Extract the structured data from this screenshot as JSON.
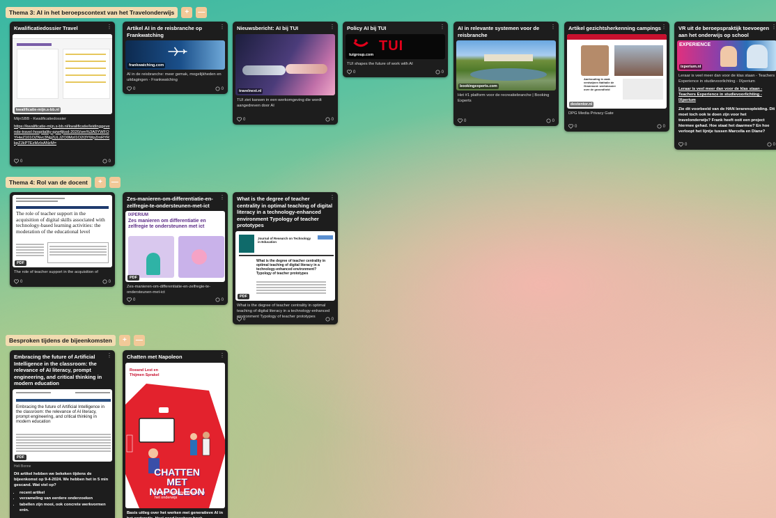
{
  "sections": [
    {
      "title": "Thema 3: AI in het beroepscontext van het Travelonderwijs",
      "cards": [
        {
          "title": "Kwalificatiedossier Travel",
          "thumb_source": "kwalificatie-mijn.s-bb.nl",
          "desc": "MijnSBB - Kwalificatiedossier",
          "link": "https://kwalificatie-mijn.s-bb.nl/kwalificatie/leidinggevende-travel-hospitality-qzw4jkxd-2020/om%3A0YWFOYHwZ101OZNvc3Ng2ULJZO0MzI1O2I3YWpZmRYRkpZJkPTEzMzIxANzM=",
          "likes": "0",
          "comments": "0"
        },
        {
          "title": "Artikel AI in de reisbranche op Frankwatching",
          "thumb_source": "frankwatching.com",
          "desc": "AI in de reisbranche: meer gemak, mogelijkheden en uitdagingen - Frankwatching",
          "likes": "0",
          "comments": "0"
        },
        {
          "title": "Nieuwsbericht: AI bij TUI",
          "thumb_source": "travelnext.nl",
          "desc": "TUI ziet kansen in een werkomgeving die wordt aangedreven door AI",
          "likes": "0",
          "comments": "0"
        },
        {
          "title": "Policy AI bij TUI",
          "thumb_source": "tuigroup.com",
          "logo_text": "TUI",
          "desc": "TUI shapes the future of work with AI",
          "likes": "0",
          "comments": "0"
        },
        {
          "title": "AI in relevante systemen voor de reisbranche",
          "thumb_source": "bookingexperts.com",
          "desc": "Het #1 platform voor de recreatiebranche | Booking Experts",
          "likes": "0",
          "comments": "0"
        },
        {
          "title": "Artikel gezichtsherkenning campings",
          "thumb_source": "destentor.nl",
          "thumb_caption": "Aanhouding in zaak verdwijnen Nathalie de Grammont: werkdossier over de gezondheid",
          "desc": "DPG Media Privacy Gate",
          "likes": "0",
          "comments": "0"
        },
        {
          "title": "VR uit de beroepspraktijk toevoegen aan het onderwijs op school",
          "thumb_source": "ixperium.nl",
          "thumb_label": "EXPERIENCE",
          "desc": "Leraar is veel meer dan voor de klas staan - Teachers Experience in studievoorlichting - IXperium",
          "link": "Leraar is veel meer dan voor de klas staan - Teachers Experience in studievoorlichting - IXperium",
          "body": "Zie dit voorbeeld van de HAN lerarenopleiding. Dit moet toch ook te doen zijn voor het travelonderwijs? Frank heeft ooit een project hiermee gehad. Hoe staat het daarmee? En hoe verloopt het lijntje tussen Marcella en Diane?",
          "likes": "0",
          "comments": "0"
        }
      ]
    },
    {
      "title": "Thema 4: Rol van de docent",
      "cards": [
        {
          "title": "",
          "paper_heading": "The role of teacher support in the acquisition of digital skills associated with technology-based learning activities: the moderation of the educational level",
          "badge": "PDF",
          "desc": "The role of teacher support in the acquisition of",
          "likes": "0",
          "comments": "0"
        },
        {
          "title": "Zes-manieren-om-differentiatie-en-zelfregie-te-ondersteunen-met-ict",
          "thumb_label": "IXPERIUM",
          "thumb_heading": "Zes manieren om differentiatie en zelfregie te ondersteunen met ict",
          "badge": "PDF",
          "desc": "Zes-manieren-om-differentiatie-en-zelfregie-te-ondersteunen-met-ict",
          "likes": "0",
          "comments": "0"
        },
        {
          "title": "What is the degree of teacher centrality in optimal teaching of digital literacy in a technology-enhanced environment Typology of teacher prototypes",
          "journal": "Journal of Research on Technology in Education",
          "paper_heading": "What is the degree of teacher centrality in optimal teaching of digital literacy in a technology-enhanced environment? Typology of teacher prototypes",
          "badge": "PDF",
          "desc": "What is the degree of teacher centrality in optimal teaching of digital literacy in a technology-enhanced environment Typology of teacher prototypes",
          "likes": "0",
          "comments": "0"
        }
      ]
    },
    {
      "title": "Besproken tijdens de bijeenkomsten",
      "cards": [
        {
          "title": "Embracing the future of Artificial Intelligence in the classroom: the relevance of AI literacy, prompt engineering, and critical thinking in modern education",
          "paper_heading": "Embracing the future of Artificial Intelligence in the classroom: the relevance of AI literacy, prompt engineering, and critical thinking in modern education",
          "badge": "PDF",
          "author": "Heli Bonne",
          "body": "Dit artikel hebben we bekeken tijdens de bijeenkomst op 9-4-2024. We hebben het in 5 min gescand. Wat viel op?",
          "bullets": [
            "recent artikel",
            "verzameling van eerdere onderzoeken",
            "tabellen zijn mooi, ook concrete werkvormen enin."
          ]
        },
        {
          "title": "Chatten met Napoleon",
          "book_authors": "Roeand Lest en Thijmen Sprakel",
          "book_title": "CHATTEN MET NAPOLEON",
          "book_subtitle": "Werken met generatieve AI in het onderwijs",
          "desc": "Basis uitleg over het werken met generatieve AI in het onderwijs. Heel goed leesbaar boek."
        }
      ]
    }
  ],
  "section_add_symbol": "+",
  "section_collapse_symbol": "—",
  "card_menu_symbol": "⋮"
}
